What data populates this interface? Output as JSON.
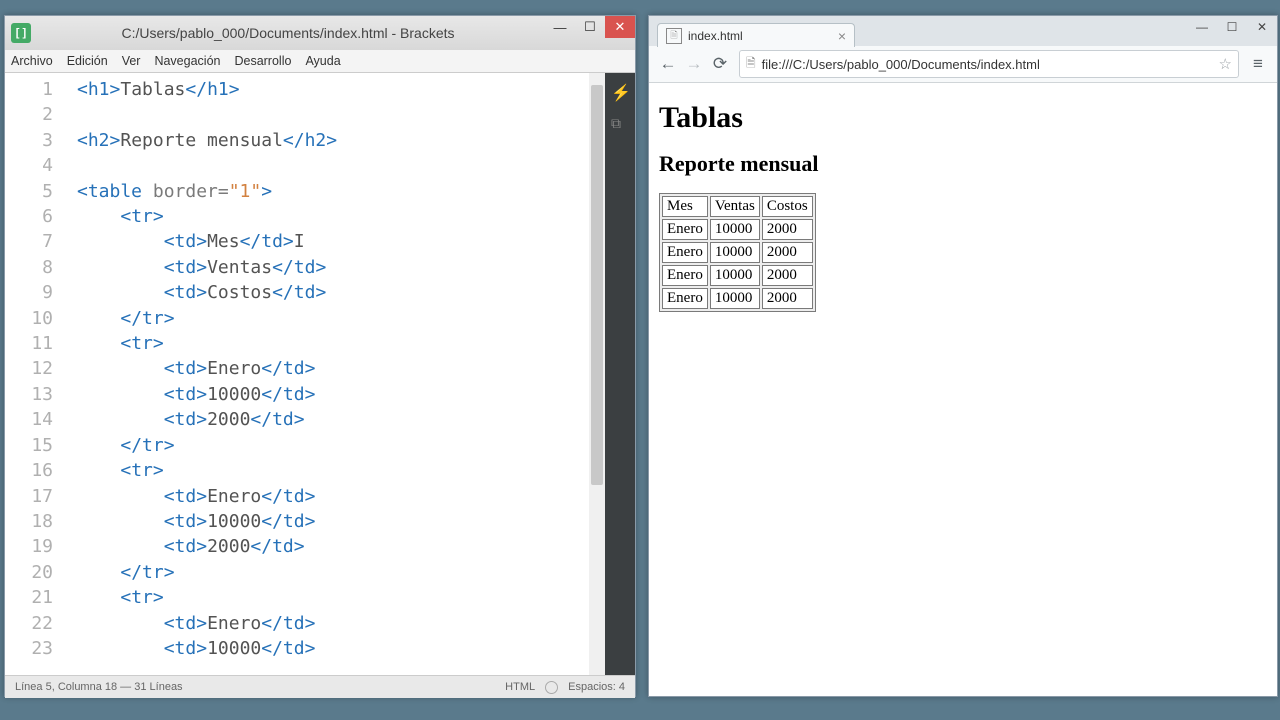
{
  "brackets": {
    "title": "C:/Users/pablo_000/Documents/index.html - Brackets",
    "menu": [
      "Archivo",
      "Edición",
      "Ver",
      "Navegación",
      "Desarrollo",
      "Ayuda"
    ],
    "lines": [
      1,
      2,
      3,
      4,
      5,
      6,
      7,
      8,
      9,
      10,
      11,
      12,
      13,
      14,
      15,
      16,
      17,
      18,
      19,
      20,
      21,
      22,
      23
    ],
    "status_left": "Línea 5, Columna 18 — 31 Líneas",
    "status_lang": "HTML",
    "status_right": "Espacios: 4",
    "code": {
      "l1a": "<h1>",
      "l1b": "Tablas",
      "l1c": "</h1>",
      "l3a": "<h2>",
      "l3b": "Reporte mensual",
      "l3c": "</h2>",
      "l5a": "<table ",
      "l5attr": "border=",
      "l5str": "\"1\"",
      "l5b": ">",
      "tr_o": "<tr>",
      "tr_c": "</tr>",
      "td_o": "<td>",
      "td_c": "</td>",
      "c_mes": "Mes",
      "c_vent": "Ventas",
      "c_cost": "Costos",
      "c_enero": "Enero",
      "c_10000": "10000",
      "c_2000": "2000",
      "cursor": "I"
    }
  },
  "chrome": {
    "tab_title": "index.html",
    "url": "file:///C:/Users/pablo_000/Documents/index.html",
    "page": {
      "h1": "Tablas",
      "h2": "Reporte mensual",
      "table": {
        "header": [
          "Mes",
          "Ventas",
          "Costos"
        ],
        "rows": [
          [
            "Enero",
            "10000",
            "2000"
          ],
          [
            "Enero",
            "10000",
            "2000"
          ],
          [
            "Enero",
            "10000",
            "2000"
          ],
          [
            "Enero",
            "10000",
            "2000"
          ]
        ]
      }
    }
  }
}
